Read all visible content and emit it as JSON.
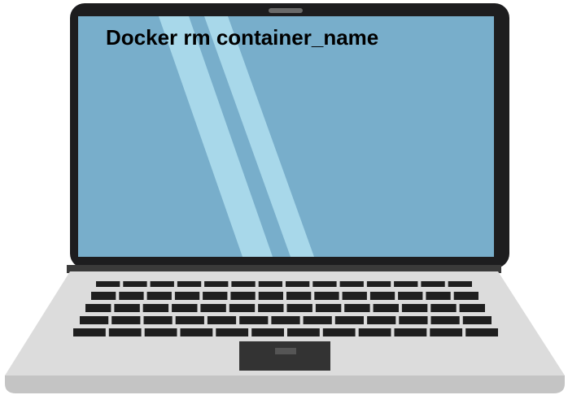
{
  "screen": {
    "caption": "Docker rm container_name"
  },
  "illustration": {
    "name": "laptop-icon",
    "colors": {
      "bezel": "#1d1d1f",
      "screen": "#78aecb",
      "screen_glare": "#a8d8ea",
      "base_top": "#dcdcdc",
      "base_edge": "#c4c4c4",
      "keyboard_well": "#dcdcdc",
      "keys": "#1f1f1f",
      "trackpad_frame": "#333333",
      "trackpad": "#555555",
      "caption_text": "#000000"
    }
  }
}
